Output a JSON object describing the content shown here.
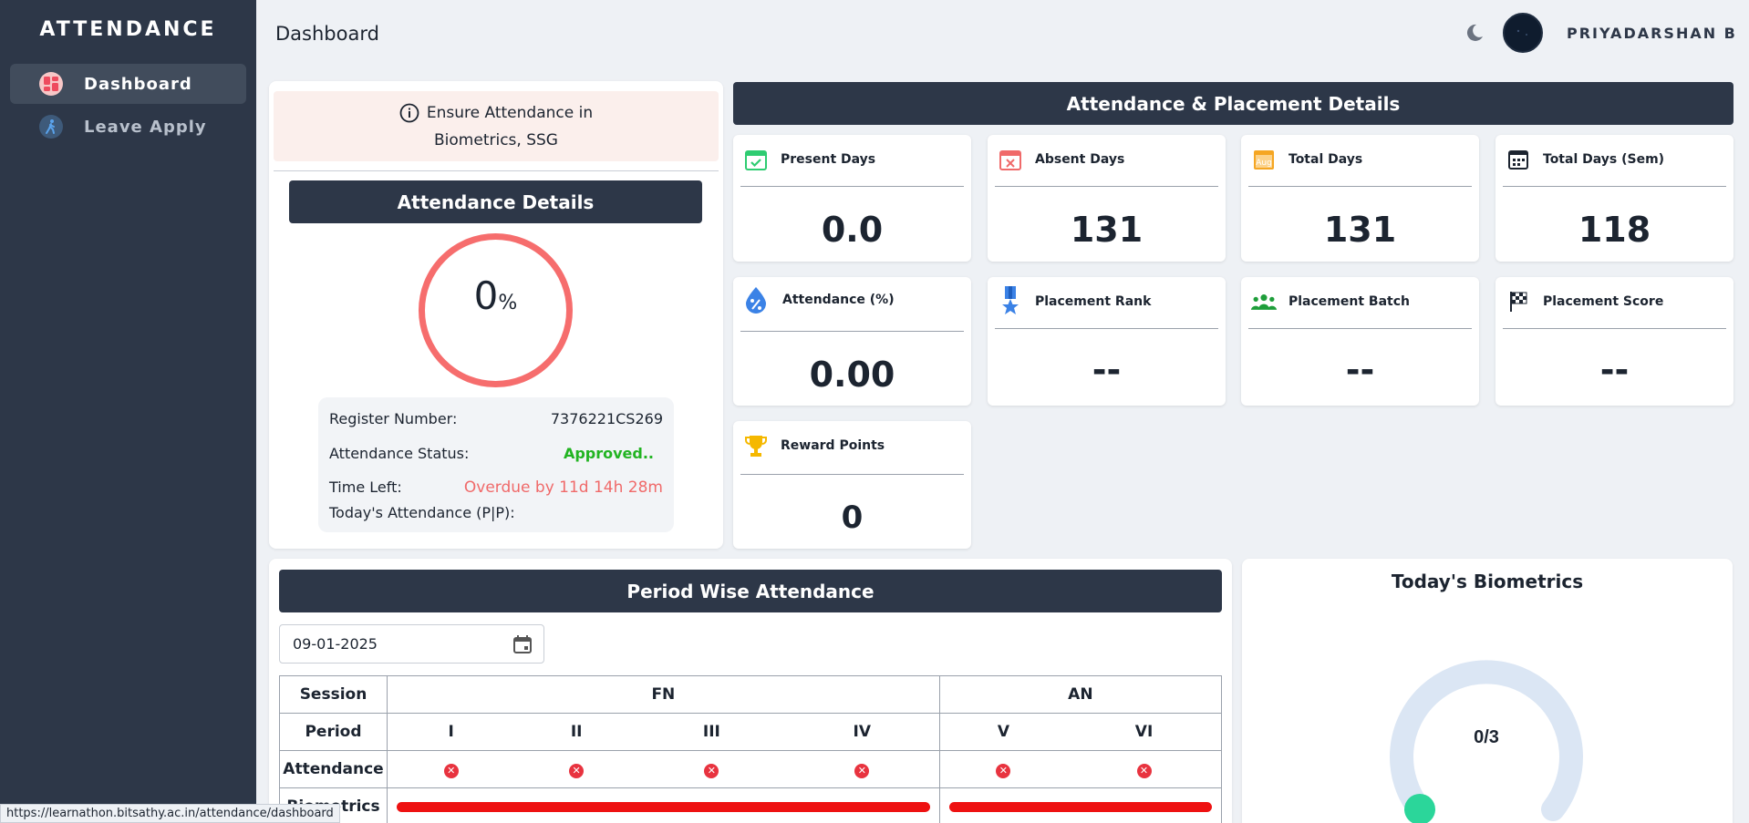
{
  "sidebar": {
    "brand": "ATTENDANCE",
    "items": [
      {
        "label": "Dashboard",
        "icon": "dashboard-icon",
        "active": true
      },
      {
        "label": "Leave Apply",
        "icon": "walking-person-icon",
        "active": false
      }
    ]
  },
  "header": {
    "title": "Dashboard",
    "user_name": "PRIYADARSHAN B",
    "theme_icon": "moon-icon"
  },
  "notice": {
    "line1": "Ensure Attendance in",
    "line2": "Biometrics, SSG"
  },
  "attendance_details": {
    "title": "Attendance Details",
    "percent_value": "0",
    "percent_sign": "%",
    "register_label": "Register Number:",
    "register_value": "7376221CS269",
    "status_label": "Attendance Status:",
    "status_value": "Approved..",
    "time_label": "Time Left:",
    "time_value": "Overdue by 11d 14h 28m",
    "today_label": "Today's Attendance (P|P):"
  },
  "placement": {
    "title": "Attendance & Placement Details",
    "cards": [
      {
        "label": "Present Days",
        "value": "0.0",
        "icon": "calendar-check-icon"
      },
      {
        "label": "Absent Days",
        "value": "131",
        "icon": "calendar-x-icon"
      },
      {
        "label": "Total Days",
        "value": "131",
        "icon": "calendar-aug-icon"
      },
      {
        "label": "Total Days (Sem)",
        "value": "118",
        "icon": "calendar-icon"
      },
      {
        "label": "Attendance (%)",
        "value": "0.00",
        "icon": "percent-drop-icon"
      },
      {
        "label": "Placement Rank",
        "value": "--",
        "icon": "medal-icon"
      },
      {
        "label": "Placement Batch",
        "value": "--",
        "icon": "users-icon"
      },
      {
        "label": "Placement Score",
        "value": "--",
        "icon": "checkered-flag-icon"
      },
      {
        "label": "Reward Points",
        "value": "0",
        "icon": "trophy-icon"
      }
    ]
  },
  "period_wise": {
    "title": "Period Wise Attendance",
    "date": "09-01-2025",
    "session_label": "Session",
    "fn_label": "FN",
    "an_label": "AN",
    "period_label": "Period",
    "periods": [
      "I",
      "II",
      "III",
      "IV",
      "V",
      "VI"
    ],
    "attendance_label": "Attendance",
    "biometrics_label": "Biometrics"
  },
  "biometrics": {
    "title": "Today's Biometrics",
    "count": "0/3",
    "fraction": 0
  },
  "status_bar": {
    "url": "https://learnathon.bitsathy.ac.in/attendance/dashboard"
  },
  "colors": {
    "sidebar": "#2d3748",
    "ring": "#f66d6d",
    "approved": "#22b422",
    "overdue": "#f06a6a",
    "gauge_track": "#dbe6f4",
    "gauge_knob": "#2bd69a"
  }
}
